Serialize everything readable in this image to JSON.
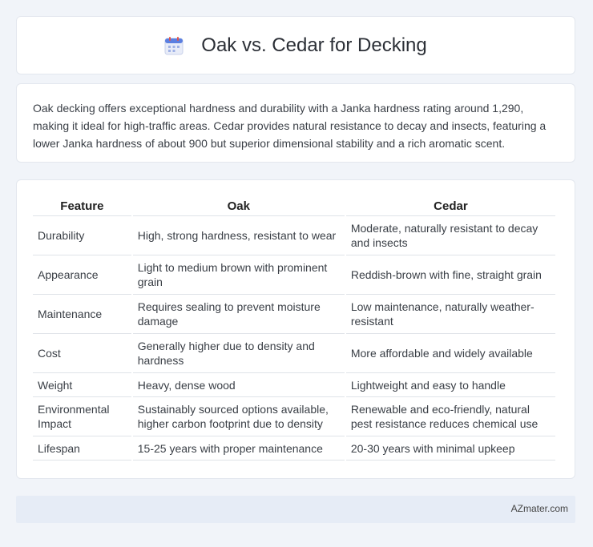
{
  "header": {
    "title": "Oak vs. Cedar for Decking",
    "icon": "calendar-icon"
  },
  "intro": {
    "text": "Oak decking offers exceptional hardness and durability with a Janka hardness rating around 1,290, making it ideal for high-traffic areas. Cedar provides natural resistance to decay and insects, featuring a lower Janka hardness of about 900 but superior dimensional stability and a rich aromatic scent."
  },
  "table": {
    "headers": [
      "Feature",
      "Oak",
      "Cedar"
    ],
    "rows": [
      [
        "Durability",
        "High, strong hardness, resistant to wear",
        "Moderate, naturally resistant to decay and insects"
      ],
      [
        "Appearance",
        "Light to medium brown with prominent grain",
        "Reddish-brown with fine, straight grain"
      ],
      [
        "Maintenance",
        "Requires sealing to prevent moisture damage",
        "Low maintenance, naturally weather-resistant"
      ],
      [
        "Cost",
        "Generally higher due to density and hardness",
        "More affordable and widely available"
      ],
      [
        "Weight",
        "Heavy, dense wood",
        "Lightweight and easy to handle"
      ],
      [
        "Environmental Impact",
        "Sustainably sourced options available, higher carbon footprint due to density",
        "Renewable and eco-friendly, natural pest resistance reduces chemical use"
      ],
      [
        "Lifespan",
        "15-25 years with proper maintenance",
        "20-30 years with minimal upkeep"
      ]
    ]
  },
  "footer": {
    "brand": "AZmater.com"
  }
}
